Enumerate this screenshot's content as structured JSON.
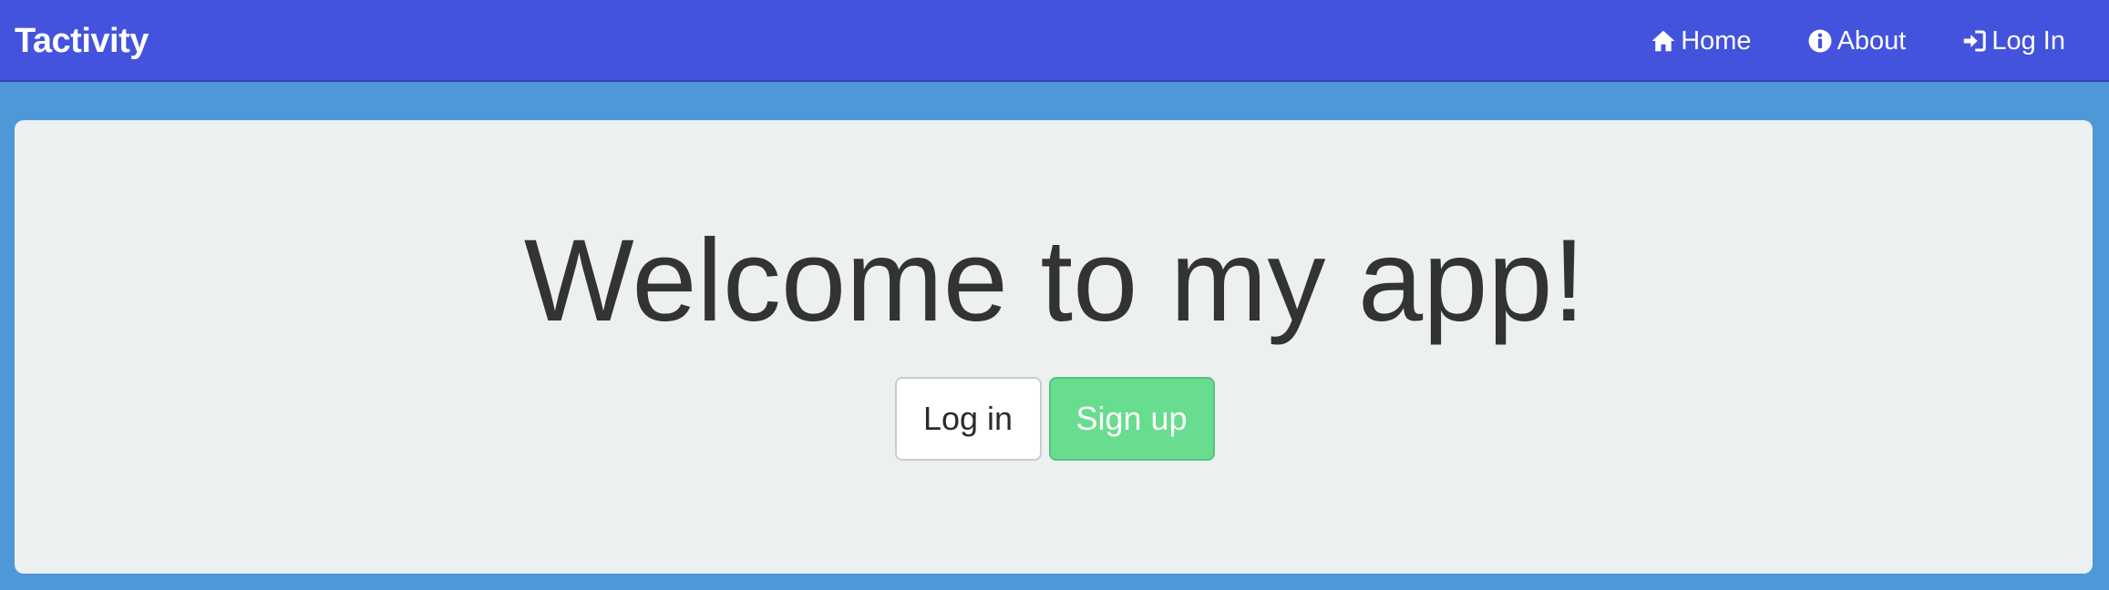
{
  "navbar": {
    "brand": "Tactivity",
    "links": [
      {
        "label": "Home",
        "icon": "home-icon"
      },
      {
        "label": "About",
        "icon": "info-circle-icon"
      },
      {
        "label": "Log In",
        "icon": "log-in-icon"
      }
    ],
    "background": "#4353dd"
  },
  "hero": {
    "title": "Welcome to my app!",
    "login_label": "Log in",
    "signup_label": "Sign up",
    "panel_background": "#ecf0f1",
    "signup_color": "#68dc8f"
  },
  "page_background": "#4e98d8"
}
